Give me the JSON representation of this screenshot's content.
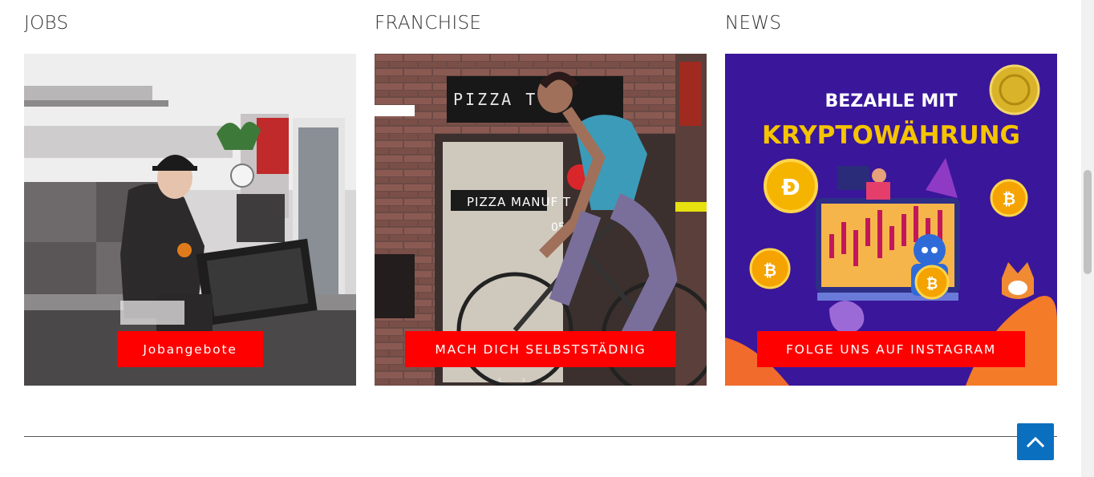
{
  "columns": {
    "jobs": {
      "title": "JOBS",
      "button_label": "Jobangebote"
    },
    "franchise": {
      "title": "FRANCHISE",
      "button_label": "MACH DICH SELBSTSTÄDNIG",
      "sign_text": "PIZZA T",
      "inner_sign_text": "PIZZA MANUF    T",
      "phone_text": "0511"
    },
    "news": {
      "title": "NEWS",
      "button_label": "FOLGE UNS AUF INSTAGRAM",
      "headline_1": "BEZAHLE MIT",
      "headline_2": "KRYPTOWÄHRUNG"
    }
  },
  "carousel": {
    "prev_symbol": "‹",
    "next_symbol": "›"
  },
  "colors": {
    "cta": "#ff0000",
    "scroll_top": "#0b6fbf",
    "news_bg": "#3a169a",
    "crypto_yellow": "#f5c400"
  }
}
